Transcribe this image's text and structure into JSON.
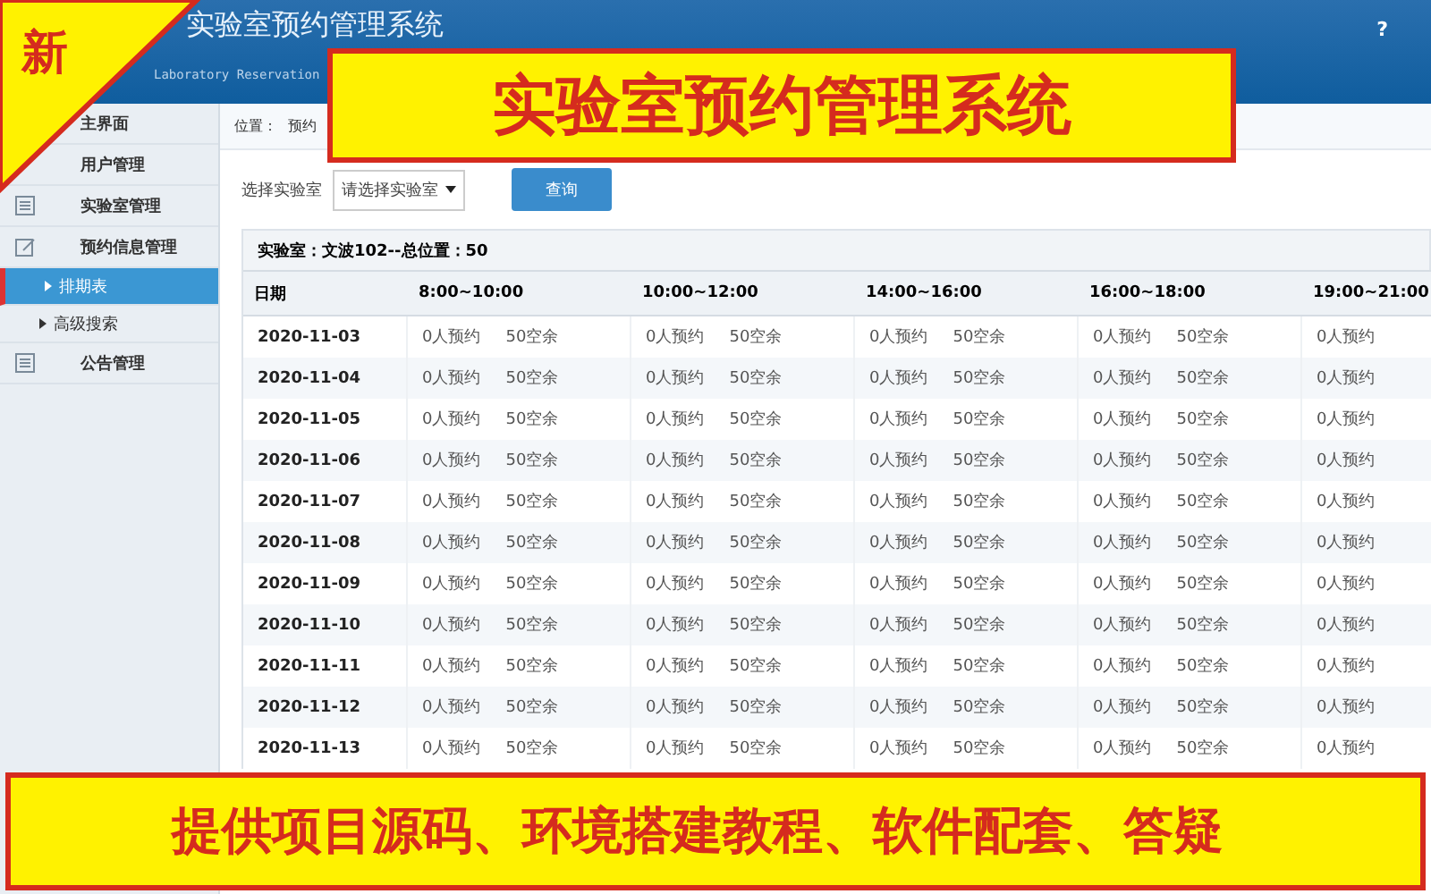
{
  "header": {
    "title": "实验室预约管理系统",
    "subtitle": "Laboratory Reservation",
    "help": "?"
  },
  "sidebar": {
    "items": [
      {
        "label": "主界面",
        "kind": "top",
        "selected": false
      },
      {
        "label": "用户管理",
        "kind": "top",
        "selected": false
      },
      {
        "label": "实验室管理",
        "kind": "icon",
        "selected": false
      },
      {
        "label": "预约信息管理",
        "kind": "edit",
        "selected": false
      },
      {
        "label": "排期表",
        "kind": "sub",
        "selected": true
      },
      {
        "label": "高级搜索",
        "kind": "sub",
        "selected": false
      },
      {
        "label": "公告管理",
        "kind": "icon",
        "selected": false
      }
    ]
  },
  "breadcrumb": {
    "label": "位置：",
    "path": "预约"
  },
  "filter": {
    "label": "选择实验室",
    "select": "请选择实验室",
    "button": "查询"
  },
  "table": {
    "caption": "实验室：文波102--总位置：50",
    "columns": [
      "日期",
      "8:00~10:00",
      "10:00~12:00",
      "14:00~16:00",
      "16:00~18:00",
      "19:00~21:00"
    ],
    "rows": [
      {
        "date": "2020-11-03",
        "slots": [
          [
            "0人预约",
            "50空余"
          ],
          [
            "0人预约",
            "50空余"
          ],
          [
            "0人预约",
            "50空余"
          ],
          [
            "0人预约",
            "50空余"
          ],
          [
            "0人预约"
          ]
        ]
      },
      {
        "date": "2020-11-04",
        "slots": [
          [
            "0人预约",
            "50空余"
          ],
          [
            "0人预约",
            "50空余"
          ],
          [
            "0人预约",
            "50空余"
          ],
          [
            "0人预约",
            "50空余"
          ],
          [
            "0人预约"
          ]
        ]
      },
      {
        "date": "2020-11-05",
        "slots": [
          [
            "0人预约",
            "50空余"
          ],
          [
            "0人预约",
            "50空余"
          ],
          [
            "0人预约",
            "50空余"
          ],
          [
            "0人预约",
            "50空余"
          ],
          [
            "0人预约"
          ]
        ]
      },
      {
        "date": "2020-11-06",
        "slots": [
          [
            "0人预约",
            "50空余"
          ],
          [
            "0人预约",
            "50空余"
          ],
          [
            "0人预约",
            "50空余"
          ],
          [
            "0人预约",
            "50空余"
          ],
          [
            "0人预约"
          ]
        ]
      },
      {
        "date": "2020-11-07",
        "slots": [
          [
            "0人预约",
            "50空余"
          ],
          [
            "0人预约",
            "50空余"
          ],
          [
            "0人预约",
            "50空余"
          ],
          [
            "0人预约",
            "50空余"
          ],
          [
            "0人预约"
          ]
        ]
      },
      {
        "date": "2020-11-08",
        "slots": [
          [
            "0人预约",
            "50空余"
          ],
          [
            "0人预约",
            "50空余"
          ],
          [
            "0人预约",
            "50空余"
          ],
          [
            "0人预约",
            "50空余"
          ],
          [
            "0人预约"
          ]
        ]
      },
      {
        "date": "2020-11-09",
        "slots": [
          [
            "0人预约",
            "50空余"
          ],
          [
            "0人预约",
            "50空余"
          ],
          [
            "0人预约",
            "50空余"
          ],
          [
            "0人预约",
            "50空余"
          ],
          [
            "0人预约"
          ]
        ]
      },
      {
        "date": "2020-11-10",
        "slots": [
          [
            "0人预约",
            "50空余"
          ],
          [
            "0人预约",
            "50空余"
          ],
          [
            "0人预约",
            "50空余"
          ],
          [
            "0人预约",
            "50空余"
          ],
          [
            "0人预约"
          ]
        ]
      },
      {
        "date": "2020-11-11",
        "slots": [
          [
            "0人预约",
            "50空余"
          ],
          [
            "0人预约",
            "50空余"
          ],
          [
            "0人预约",
            "50空余"
          ],
          [
            "0人预约",
            "50空余"
          ],
          [
            "0人预约"
          ]
        ]
      },
      {
        "date": "2020-11-12",
        "slots": [
          [
            "0人预约",
            "50空余"
          ],
          [
            "0人预约",
            "50空余"
          ],
          [
            "0人预约",
            "50空余"
          ],
          [
            "0人预约",
            "50空余"
          ],
          [
            "0人预约"
          ]
        ]
      },
      {
        "date": "2020-11-13",
        "slots": [
          [
            "0人预约",
            "50空余"
          ],
          [
            "0人预约",
            "50空余"
          ],
          [
            "0人预约",
            "50空余"
          ],
          [
            "0人预约",
            "50空余"
          ],
          [
            "0人预约"
          ]
        ]
      }
    ]
  },
  "overlays": {
    "corner": "新",
    "top_banner": "实验室预约管理系统",
    "bottom_banner": "提供项目源码、环境搭建教程、软件配套、答疑"
  }
}
